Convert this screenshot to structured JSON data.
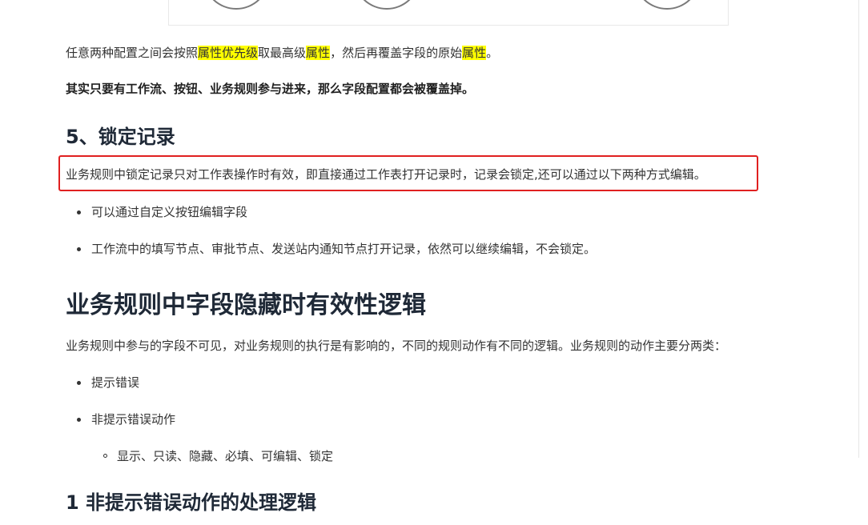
{
  "para1": {
    "part1": "任意两种配置之间会按照",
    "hl1": "属性优先级",
    "part2": "取最高级",
    "hl2": "属性",
    "part3": "，然后再覆盖字段的原始",
    "hl3": "属性",
    "part4": "。"
  },
  "para2": "其实只要有工作流、按钮、业务规则参与进来，那么字段配置都会被覆盖掉。",
  "heading_lock": "5、锁定记录",
  "para_lock": "业务规则中锁定记录只对工作表操作时有效，即直接通过工作表打开记录时，记录会锁定,还可以通过以下两种方式编辑。",
  "lock_items": [
    "可以通过自定义按钮编辑字段",
    "工作流中的填写节点、审批节点、发送站内通知节点打开记录，依然可以继续编辑，不会锁定。"
  ],
  "heading_hidden": "业务规则中字段隐藏时有效性逻辑",
  "para_hidden": "业务规则中参与的字段不可见，对业务规则的执行是有影响的，不同的规则动作有不同的逻辑。业务规则的动作主要分两类：",
  "action_items": [
    "提示错误",
    "非提示错误动作"
  ],
  "sub_item": "显示、只读、隐藏、必填、可编辑、锁定",
  "heading_non_error": "1 非提示错误动作的处理逻辑",
  "colors": {
    "highlight": "#ffff00",
    "redbox": "#e02020"
  }
}
